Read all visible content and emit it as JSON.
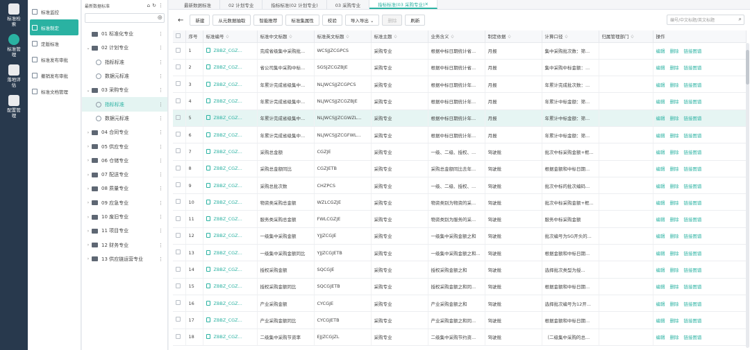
{
  "rail": [
    {
      "label": "标准检索",
      "icon": "document-search-icon"
    },
    {
      "label": "标准管理",
      "icon": "standard-manage-icon",
      "active": true
    },
    {
      "label": "落地评估",
      "icon": "chart-icon"
    },
    {
      "label": "配置管理",
      "icon": "config-icon"
    }
  ],
  "submenu": [
    {
      "label": "标准监控"
    },
    {
      "label": "标准制定",
      "active": true
    },
    {
      "label": "定版标准"
    },
    {
      "label": "标准发布审批"
    },
    {
      "label": "撤销发布审批"
    },
    {
      "label": "标准文档管理"
    }
  ],
  "tree": {
    "title": "最新数据标准",
    "nodes": [
      {
        "label": "01 标准化专业",
        "level": 0,
        "arrow": "",
        "type": "folder"
      },
      {
        "label": "02 计划专业",
        "level": 0,
        "arrow": "⌄",
        "type": "folder"
      },
      {
        "label": "指标标准",
        "level": 1,
        "arrow": "",
        "type": "item"
      },
      {
        "label": "数据元标准",
        "level": 1,
        "arrow": "",
        "type": "item"
      },
      {
        "label": "03 采购专业",
        "level": 0,
        "arrow": "⌄",
        "type": "folder"
      },
      {
        "label": "指标标准",
        "level": 1,
        "arrow": "",
        "type": "item",
        "active": true
      },
      {
        "label": "数据元标准",
        "level": 1,
        "arrow": "",
        "type": "item"
      },
      {
        "label": "04 合同专业",
        "level": 0,
        "arrow": "›",
        "type": "folder"
      },
      {
        "label": "05 供应专业",
        "level": 0,
        "arrow": "›",
        "type": "folder"
      },
      {
        "label": "06 仓储专业",
        "level": 0,
        "arrow": "›",
        "type": "folder"
      },
      {
        "label": "07 配送专业",
        "level": 0,
        "arrow": "›",
        "type": "folder"
      },
      {
        "label": "08 质量专业",
        "level": 0,
        "arrow": "›",
        "type": "folder"
      },
      {
        "label": "09 应急专业",
        "level": 0,
        "arrow": "›",
        "type": "folder"
      },
      {
        "label": "10 废旧专业",
        "level": 0,
        "arrow": "›",
        "type": "folder"
      },
      {
        "label": "11 项目专业",
        "level": 0,
        "arrow": "›",
        "type": "folder"
      },
      {
        "label": "12 财务专业",
        "level": 0,
        "arrow": "›",
        "type": "folder"
      },
      {
        "label": "13 供应链运营专业",
        "level": 0,
        "arrow": "›",
        "type": "folder"
      }
    ]
  },
  "tabs": [
    {
      "label": "最新数据标准"
    },
    {
      "label": "02 计划专业"
    },
    {
      "label": "指标标准(02 计划专业)"
    },
    {
      "label": "03 采购专业"
    },
    {
      "label": "指标标准(03 采购专业)",
      "active": true
    }
  ],
  "toolbar": [
    "新建",
    "从元数据抽取",
    "智能推荐",
    "标准集属性",
    "校验",
    "导入导出 ⌄",
    "删除",
    "刷新"
  ],
  "search": {
    "placeholder": "编号/中文标题/英文标题"
  },
  "columns": [
    "序号",
    "标准编号 ♢",
    "标准中文标题 ♢",
    "标准英文标题 ♢",
    "标准主题 ♢",
    "业务含义 ♢",
    "制定依据 ♢",
    "计算口径 ♢",
    "归属管理部门 ♢",
    "操作"
  ],
  "ops": [
    "编辑",
    "删除",
    "链接图谱"
  ],
  "rows": [
    [
      "1",
      "ZBBZ_CGZ...",
      "完成省级集中采购批...",
      "WCSJJZCGPCS",
      "采购专业",
      "根据中标日期统计省...",
      "月报",
      "集中采购批次数：筛..."
    ],
    [
      "2",
      "ZBBZ_CGZ...",
      "省公司集中采购中标...",
      "SGSJZCGZBJE",
      "采购专业",
      "根据中标日期统计省...",
      "月报",
      "集中采购中标金额：..."
    ],
    [
      "3",
      "ZBBZ_CGZ...",
      "年累计完成省级集中...",
      "NLJWCSJJZCGPCS",
      "采购专业",
      "根据中标日期统计年...",
      "月报",
      "年累计完成批次数：..."
    ],
    [
      "4",
      "ZBBZ_CGZ...",
      "年累计完成省级集中...",
      "NLJWCSJJZCGZBJE",
      "采购专业",
      "根据中标日期统计年...",
      "月报",
      "年累计中标金额：筛..."
    ],
    [
      "5",
      "ZBBZ_CGZ...",
      "年累计完成省级集中...",
      "NLJWCSJJZCGWZL...",
      "采购专业",
      "根据中标日期统计年...",
      "月报",
      "年累计中标金额：筛..."
    ],
    [
      "6",
      "ZBBZ_CGZ...",
      "年累计完成省级集中...",
      "NLJWCSJJZCGFWL...",
      "采购专业",
      "根据中标日期统计年...",
      "月报",
      "年累计中标金额：筛..."
    ],
    [
      "7",
      "ZBBZ_CGZ...",
      "采购总金额",
      "CGZJE",
      "采购专业",
      "一级、二级、授权、...",
      "驾驶舱",
      "批次中标采购金额+框..."
    ],
    [
      "8",
      "ZBBZ_CGZ...",
      "采购总金额同比",
      "CGZJETB",
      "采购专业",
      "采购总金额同比去年...",
      "驾驶舱",
      "根据金额和中标日期..."
    ],
    [
      "9",
      "ZBBZ_CGZ...",
      "采购总批次数",
      "CHZPCS",
      "采购专业",
      "一级、二级、授权、...",
      "驾驶舱",
      "批次中标的批次编码..."
    ],
    [
      "10",
      "ZBBZ_CGZ...",
      "物资类采购总金额",
      "WZLCGZJE",
      "采购专业",
      "物资类别为物资的采...",
      "驾驶舱",
      "批次中标采购金额+框..."
    ],
    [
      "11",
      "ZBBZ_CGZ...",
      "服务类采购总金额",
      "FWLCGZJE",
      "采购专业",
      "物资类别为服务的采...",
      "驾驶舱",
      "服务中标采购金额"
    ],
    [
      "12",
      "ZBBZ_CGZ...",
      "一级集中采购金额",
      "YJJZCGJE",
      "采购专业",
      "一级集中采购金额之和",
      "驾驶舱",
      "批次编号为SG开头的..."
    ],
    [
      "13",
      "ZBBZ_CGZ...",
      "一级集中采购金额同比",
      "YJJZCGJETB",
      "采购专业",
      "一级集中采购金额之和...",
      "驾驶舱",
      "根据金额和中标日期..."
    ],
    [
      "14",
      "ZBBZ_CGZ...",
      "授权采购金额",
      "SQCGJE",
      "采购专业",
      "授权采购金额之和",
      "驾驶舱",
      "选择批次类型为授..."
    ],
    [
      "15",
      "ZBBZ_CGZ...",
      "授权采购金额同比",
      "SQCGJETB",
      "采购专业",
      "授权采购金额之和同...",
      "驾驶舱",
      "根据金额和中标日期..."
    ],
    [
      "16",
      "ZBBZ_CGZ...",
      "产业采购金额",
      "CYCGJE",
      "采购专业",
      "产业采购金额之和",
      "驾驶舱",
      "选择批次编号为12开..."
    ],
    [
      "17",
      "ZBBZ_CGZ...",
      "产业采购金额同比",
      "CYCGJETB",
      "采购专业",
      "产业采购金额之和同...",
      "驾驶舱",
      "根据金额和中标日期..."
    ],
    [
      "18",
      "ZBBZ_CGZ...",
      "二级集中采购节资率",
      "EJJZCGJZL",
      "采购专业",
      "二级集中采购节约资...",
      "驾驶舱",
      "（二级集中采购的总..."
    ]
  ],
  "selected_row": 5
}
